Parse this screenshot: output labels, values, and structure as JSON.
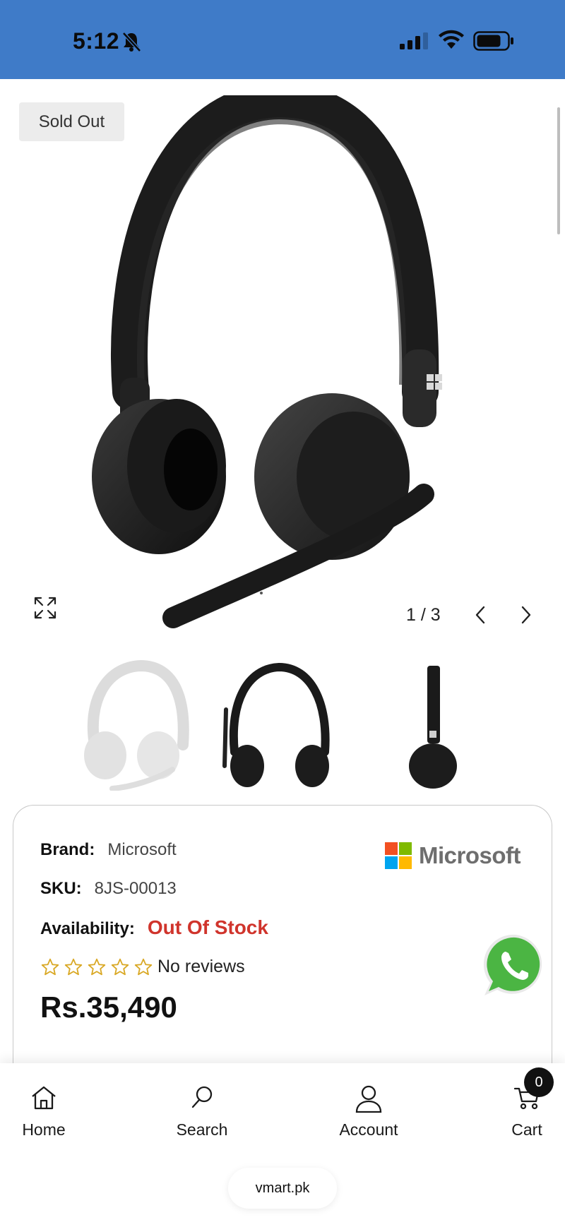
{
  "status_bar": {
    "time": "5:12",
    "background": "#3f7bc8"
  },
  "product": {
    "badge": "Sold Out",
    "gallery_counter": "1 / 3",
    "brand_label": "Brand:",
    "brand_value": "Microsoft",
    "sku_label": "SKU:",
    "sku_value": "8JS-00013",
    "availability_label": "Availability:",
    "availability_value": "Out Of Stock",
    "availability_color": "#d0342c",
    "reviews_text": "No reviews",
    "rating": 0,
    "price": "Rs.35,490",
    "brand_logo_text": "Microsoft"
  },
  "nav": {
    "items": [
      {
        "label": "Home",
        "icon": "home-icon"
      },
      {
        "label": "Search",
        "icon": "search-icon"
      },
      {
        "label": "Account",
        "icon": "account-icon"
      },
      {
        "label": "Cart",
        "icon": "cart-icon"
      }
    ],
    "cart_count": "0"
  },
  "browser": {
    "url": "vmart.pk"
  }
}
